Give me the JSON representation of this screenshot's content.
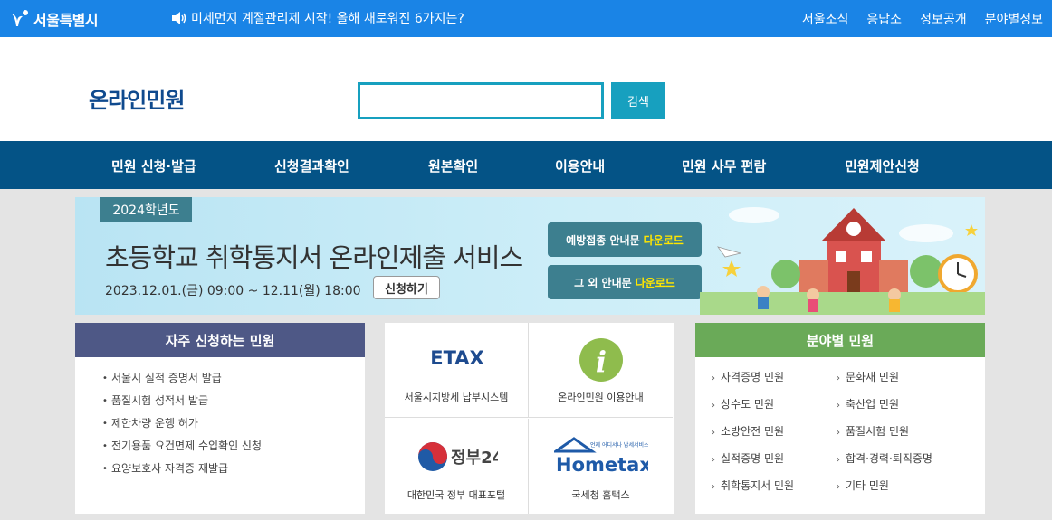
{
  "topbar": {
    "logo_text": "서울특별시",
    "notice": "미세먼지 계절관리제 시작! 올해 새로워진 6가지는?",
    "nav": [
      "서울소식",
      "응답소",
      "정보공개",
      "분야별정보"
    ]
  },
  "header": {
    "title": "온라인민원",
    "search_placeholder": "",
    "search_button": "검색"
  },
  "main_nav": [
    "민원 신청·발급",
    "신청결과확인",
    "원본확인",
    "이용안내",
    "민원 사무 편람",
    "민원제안신청"
  ],
  "banner": {
    "year_tag": "2024학년도",
    "title": "초등학교 취학통지서 온라인제출 서비스",
    "period": "2023.12.01.(금) 09:00 ~ 12.11(월) 18:00",
    "apply_button": "신청하기",
    "download_buttons": [
      {
        "label": "예방접종 안내문",
        "action": "다운로드"
      },
      {
        "label": "그 외 안내문",
        "action": "다운로드"
      }
    ]
  },
  "frequent": {
    "title": "자주 신청하는 민원",
    "items": [
      "서울시 실적 증명서 발급",
      "품질시험 성적서 발급",
      "제한차량 운행 허가",
      "전기용품 요건면제 수입확인 신청",
      "요양보호사 자격증 재발급"
    ]
  },
  "services": [
    {
      "logo": "ETAX",
      "label": "서울시지방세 납부시스템",
      "icon": "etax-logo"
    },
    {
      "logo": "i",
      "label": "온라인민원 이용안내",
      "icon": "info-icon"
    },
    {
      "logo": "정부24",
      "label": "대한민국 정부 대표포털",
      "icon": "gov24-logo"
    },
    {
      "logo": "Hometax.",
      "logo_sub": "언제 어디서나 납세서비스",
      "label": "국세청 홈택스",
      "icon": "hometax-logo"
    }
  ],
  "by_field": {
    "title": "분야별 민원",
    "items": [
      "자격증명 민원",
      "문화재 민원",
      "상수도 민원",
      "축산업 민원",
      "소방안전 민원",
      "품질시험 민원",
      "실적증명 민원",
      "합격·경력·퇴직증명",
      "취학통지서 민원",
      "기타 민원"
    ]
  },
  "colors": {
    "topbar": "#1a84e6",
    "main_nav": "#045386",
    "accent": "#17a0bf",
    "frequent_head": "#4e5886",
    "field_head": "#6aaa58",
    "highlight": "#ffe600"
  }
}
